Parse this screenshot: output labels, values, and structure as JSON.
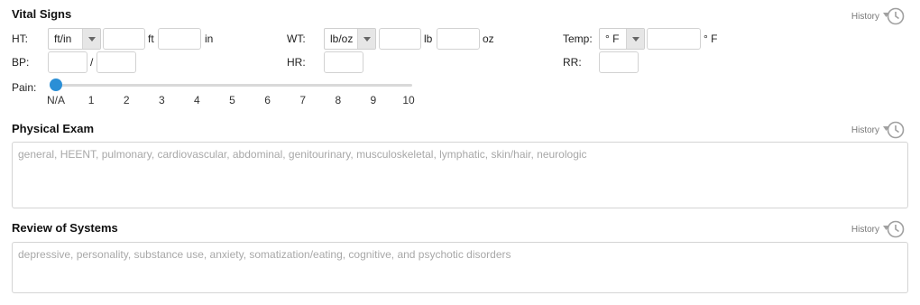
{
  "vital_signs": {
    "title": "Vital Signs",
    "history_label": "History",
    "ht": {
      "label": "HT:",
      "unit_select": "ft/in",
      "unit1": "ft",
      "unit2": "in",
      "value1": "",
      "value2": ""
    },
    "wt": {
      "label": "WT:",
      "unit_select": "lb/oz",
      "unit1": "lb",
      "unit2": "oz",
      "value1": "",
      "value2": ""
    },
    "temp": {
      "label": "Temp:",
      "unit_select": "° F",
      "unit": "° F",
      "value": ""
    },
    "bp": {
      "label": "BP:",
      "separator": "/",
      "systolic": "",
      "diastolic": ""
    },
    "hr": {
      "label": "HR:",
      "value": ""
    },
    "rr": {
      "label": "RR:",
      "value": ""
    },
    "pain": {
      "label": "Pain:",
      "selected": "N/A",
      "ticks": [
        "N/A",
        "1",
        "2",
        "3",
        "4",
        "5",
        "6",
        "7",
        "8",
        "9",
        "10"
      ]
    }
  },
  "physical_exam": {
    "title": "Physical Exam",
    "history_label": "History",
    "placeholder": "general, HEENT, pulmonary, cardiovascular, abdominal, genitourinary, musculoskeletal, lymphatic, skin/hair, neurologic",
    "value": ""
  },
  "review_of_systems": {
    "title": "Review of Systems",
    "history_label": "History",
    "placeholder": "depressive, personality, substance use, anxiety, somatization/eating, cognitive, and psychotic disorders",
    "value": ""
  },
  "colors": {
    "accent": "#2b8fd6",
    "slider_track": "#d9d9d9",
    "history_icon": "#9a9a9a"
  }
}
